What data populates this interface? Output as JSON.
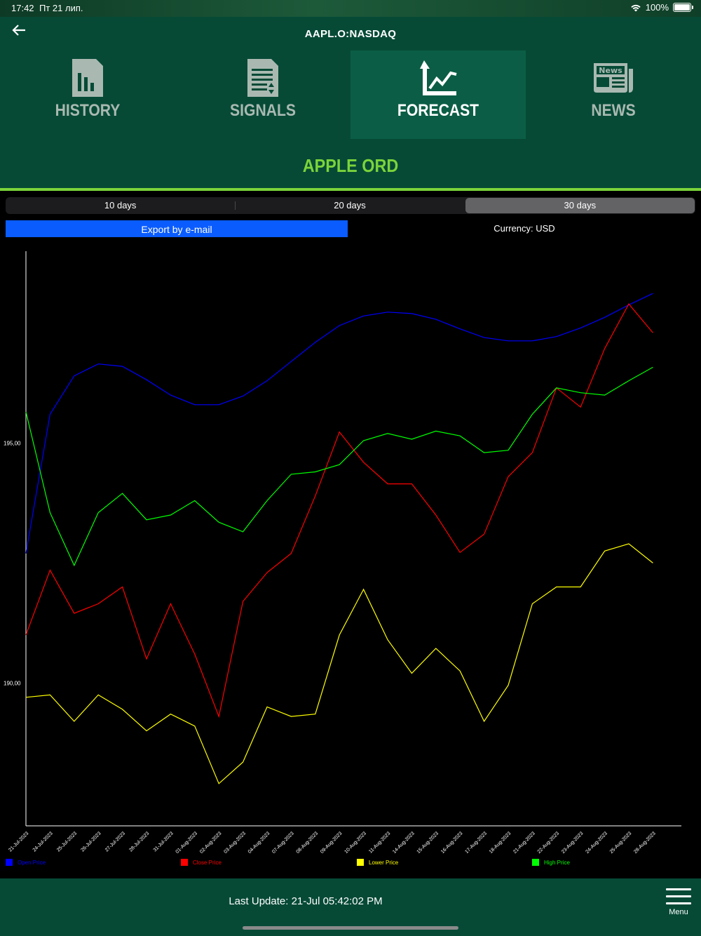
{
  "status": {
    "time": "17:42",
    "date": "Пт 21 лип.",
    "battery": "100%"
  },
  "header": {
    "title": "AAPL.O:NASDAQ"
  },
  "tabs": [
    {
      "label": "HISTORY",
      "icon": "history-chart-icon"
    },
    {
      "label": "SIGNALS",
      "icon": "signals-document-icon"
    },
    {
      "label": "FORECAST",
      "icon": "forecast-trend-icon",
      "active": true
    },
    {
      "label": "NEWS",
      "icon": "news-icon",
      "icon_text": "News"
    }
  ],
  "company": {
    "name": "APPLE ORD"
  },
  "periods": [
    "10 days",
    "20 days",
    "30 days"
  ],
  "selected_period": "30 days",
  "export_label": "Export by e-mail",
  "currency_label": "Currency: USD",
  "footer": {
    "last_update": "Last Update: 21-Jul 05:42:02 PM",
    "menu_label": "Menu"
  },
  "chart_data": {
    "type": "line",
    "x": [
      "21-Jul-2023",
      "24-Jul-2023",
      "25-Jul-2023",
      "26-Jul-2023",
      "27-Jul-2023",
      "28-Jul-2023",
      "31-Jul-2023",
      "01-Aug-2023",
      "02-Aug-2023",
      "03-Aug-2023",
      "04-Aug-2023",
      "07-Aug-2023",
      "08-Aug-2023",
      "09-Aug-2023",
      "10-Aug-2023",
      "11-Aug-2023",
      "14-Aug-2023",
      "15-Aug-2023",
      "16-Aug-2023",
      "17-Aug-2023",
      "18-Aug-2023",
      "21-Aug-2023",
      "22-Aug-2023",
      "23-Aug-2023",
      "24-Aug-2023",
      "25-Aug-2023",
      "28-Aug-2023"
    ],
    "yticks": [
      "195,00",
      "190,00"
    ],
    "ylim": [
      187.02,
      199.0
    ],
    "legend_position": "bottom",
    "series": [
      {
        "name": "Open Price",
        "color": "#0000ff",
        "values": [
          192.7,
          195.6,
          196.4,
          196.65,
          196.6,
          196.32,
          196.0,
          195.8,
          195.8,
          195.98,
          196.3,
          196.7,
          197.1,
          197.45,
          197.65,
          197.73,
          197.7,
          197.58,
          197.38,
          197.2,
          197.13,
          197.13,
          197.22,
          197.4,
          197.62,
          197.88,
          198.12
        ]
      },
      {
        "name": "Close Price",
        "color": "#ff0000",
        "values": [
          191.0,
          192.35,
          191.45,
          191.65,
          192.0,
          190.5,
          191.65,
          190.6,
          189.3,
          191.7,
          192.3,
          192.7,
          193.9,
          195.23,
          194.6,
          194.15,
          194.15,
          193.5,
          192.72,
          193.1,
          194.3,
          194.8,
          196.15,
          195.75,
          196.97,
          197.9,
          197.3
        ]
      },
      {
        "name": "Lower Price",
        "color": "#ffff00",
        "values": [
          189.7,
          189.75,
          189.2,
          189.75,
          189.45,
          189.0,
          189.35,
          189.1,
          187.9,
          188.35,
          189.5,
          189.3,
          189.35,
          191.0,
          191.95,
          190.9,
          190.2,
          190.72,
          190.25,
          189.2,
          189.95,
          191.65,
          192.0,
          192.0,
          192.75,
          192.9,
          192.5
        ]
      },
      {
        "name": "High Price",
        "color": "#00ff00",
        "values": [
          195.65,
          193.55,
          192.45,
          193.55,
          193.95,
          193.4,
          193.5,
          193.8,
          193.35,
          193.15,
          193.8,
          194.35,
          194.4,
          194.55,
          195.05,
          195.2,
          195.08,
          195.25,
          195.15,
          194.8,
          194.85,
          195.6,
          196.15,
          196.05,
          196.0,
          196.3,
          196.58
        ]
      }
    ]
  }
}
